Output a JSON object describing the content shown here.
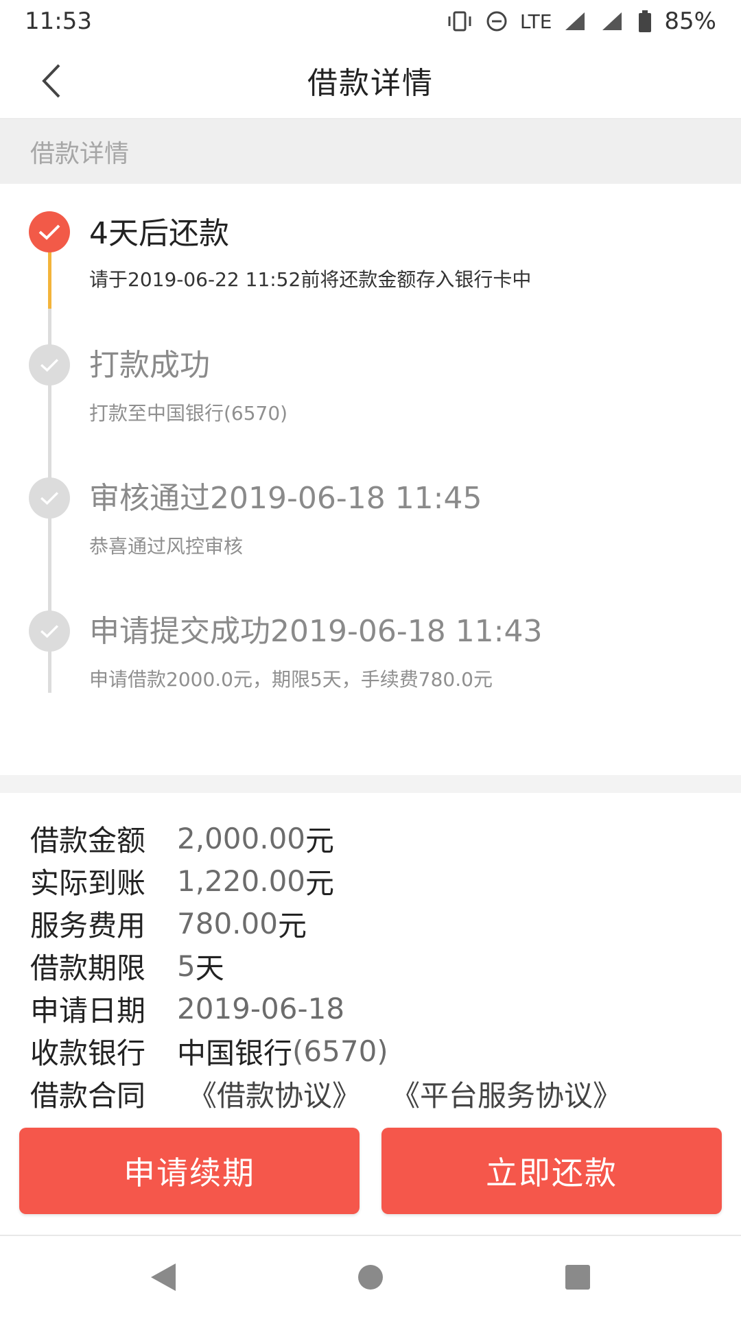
{
  "status_bar": {
    "time": "11:53",
    "network": "LTE",
    "battery": "85%"
  },
  "nav": {
    "title": "借款详情"
  },
  "section_header": "借款详情",
  "timeline": [
    {
      "title": "4天后还款",
      "subtitle": "请于2019-06-22 11:52前将还款金额存入银行卡中",
      "state": "active"
    },
    {
      "title": "打款成功",
      "subtitle": "打款至中国银行(6570)",
      "state": "done"
    },
    {
      "title": "审核通过2019-06-18 11:45",
      "subtitle": "恭喜通过风控审核",
      "state": "done"
    },
    {
      "title": "申请提交成功2019-06-18 11:43",
      "subtitle": "申请借款2000.0元，期限5天，手续费780.0元",
      "state": "done"
    }
  ],
  "details": {
    "loan_amount": {
      "label": "借款金额",
      "value": "2,000.00",
      "unit": "元"
    },
    "received": {
      "label": "实际到账",
      "value": "1,220.00",
      "unit": "元"
    },
    "service_fee": {
      "label": "服务费用",
      "value": "780.00",
      "unit": "元"
    },
    "term": {
      "label": "借款期限",
      "value": "5",
      "unit": "天"
    },
    "apply_date": {
      "label": "申请日期",
      "value": "2019-06-18"
    },
    "bank": {
      "label": "收款银行",
      "value_bank": "中国银行",
      "value_card": "(6570)"
    },
    "contract": {
      "label": "借款合同",
      "link1": "《借款协议》",
      "link2": "《平台服务协议》"
    }
  },
  "buttons": {
    "renew": "申请续期",
    "repay": "立即还款"
  },
  "colors": {
    "accent": "#f5574b",
    "timeline_active": "#f3b43b",
    "node_active": "#f25a48"
  }
}
